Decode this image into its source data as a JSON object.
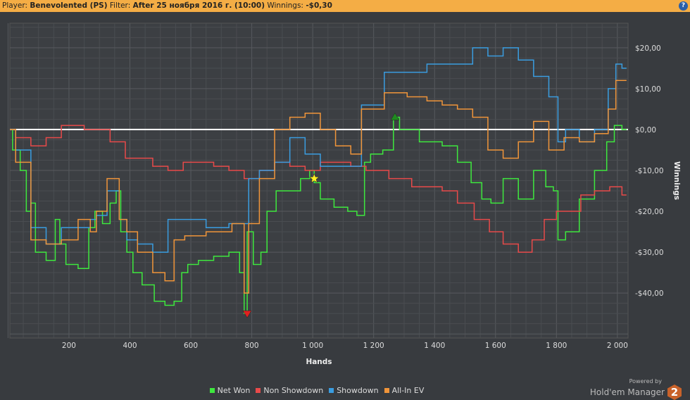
{
  "header": {
    "player_label": "Player:",
    "player": "Benevolented (PS)",
    "filter_label": "Filter:",
    "filter": "After 25 ноября 2016 г. (10:00)",
    "winnings_label": "Winnings:",
    "winnings": "-$0,30",
    "help": "?"
  },
  "brand": {
    "powered": "Powered by",
    "name": "Hold'em Manager",
    "logo": "2"
  },
  "chart_data": {
    "type": "line",
    "xlabel": "Hands",
    "ylabel": "Winnings",
    "xlim": [
      6,
      2035
    ],
    "ylim": [
      -51,
      26
    ],
    "xticks": [
      200,
      400,
      600,
      800,
      1000,
      1200,
      1400,
      1600,
      1800,
      2000
    ],
    "xtick_labels": [
      "200",
      "400",
      "600",
      "800",
      "1 000",
      "1 200",
      "1 400",
      "1 600",
      "1 800",
      "2 000"
    ],
    "yticks": [
      20,
      10,
      0,
      -10,
      -20,
      -30,
      -40
    ],
    "ytick_labels": [
      "$20,00",
      "$10,00",
      "$0,00",
      "-$10,00",
      "-$20,00",
      "-$30,00",
      "-$40,00"
    ],
    "grid": true,
    "legend_position": "bottom",
    "series": [
      {
        "name": "Net Won",
        "color": "#3ee83e",
        "points": [
          [
            0,
            0
          ],
          [
            30,
            -5
          ],
          [
            50,
            -10
          ],
          [
            70,
            -20
          ],
          [
            80,
            -18
          ],
          [
            100,
            -30
          ],
          [
            150,
            -32
          ],
          [
            160,
            -22
          ],
          [
            180,
            -28
          ],
          [
            200,
            -33
          ],
          [
            260,
            -34
          ],
          [
            270,
            -24
          ],
          [
            300,
            -20
          ],
          [
            320,
            -23
          ],
          [
            350,
            -18
          ],
          [
            360,
            -15
          ],
          [
            380,
            -25
          ],
          [
            400,
            -30
          ],
          [
            420,
            -35
          ],
          [
            460,
            -38
          ],
          [
            500,
            -42
          ],
          [
            530,
            -43
          ],
          [
            560,
            -42
          ],
          [
            580,
            -35
          ],
          [
            600,
            -33
          ],
          [
            650,
            -32
          ],
          [
            700,
            -31
          ],
          [
            750,
            -30
          ],
          [
            770,
            -35
          ],
          [
            780,
            -45
          ],
          [
            790,
            -25
          ],
          [
            820,
            -33
          ],
          [
            840,
            -30
          ],
          [
            860,
            -20
          ],
          [
            900,
            -15
          ],
          [
            940,
            -15
          ],
          [
            980,
            -12
          ],
          [
            1000,
            -10
          ],
          [
            1010,
            -13
          ],
          [
            1040,
            -17
          ],
          [
            1100,
            -19
          ],
          [
            1130,
            -20
          ],
          [
            1160,
            -21
          ],
          [
            1180,
            -8
          ],
          [
            1200,
            -6
          ],
          [
            1260,
            -5
          ],
          [
            1270,
            3
          ],
          [
            1300,
            0
          ],
          [
            1400,
            -3
          ],
          [
            1450,
            -4
          ],
          [
            1500,
            -8
          ],
          [
            1540,
            -13
          ],
          [
            1570,
            -17
          ],
          [
            1600,
            -18
          ],
          [
            1650,
            -12
          ],
          [
            1700,
            -17
          ],
          [
            1750,
            -10
          ],
          [
            1780,
            -14
          ],
          [
            1800,
            -15
          ],
          [
            1810,
            -27
          ],
          [
            1850,
            -25
          ],
          [
            1900,
            -17
          ],
          [
            1950,
            -10
          ],
          [
            1980,
            -3
          ],
          [
            2000,
            1
          ],
          [
            2030,
            0
          ]
        ]
      },
      {
        "name": "Non Showdown",
        "color": "#e84a4a",
        "points": [
          [
            0,
            0
          ],
          [
            50,
            -2
          ],
          [
            100,
            -4
          ],
          [
            150,
            -2
          ],
          [
            200,
            1
          ],
          [
            300,
            0
          ],
          [
            370,
            -3
          ],
          [
            400,
            -7
          ],
          [
            450,
            -7
          ],
          [
            500,
            -9
          ],
          [
            550,
            -10
          ],
          [
            600,
            -8
          ],
          [
            650,
            -8
          ],
          [
            700,
            -9
          ],
          [
            750,
            -10
          ],
          [
            800,
            -12
          ],
          [
            850,
            -10
          ],
          [
            900,
            -8
          ],
          [
            950,
            -9
          ],
          [
            1000,
            -10
          ],
          [
            1050,
            -8
          ],
          [
            1100,
            -8
          ],
          [
            1150,
            -9
          ],
          [
            1200,
            -10
          ],
          [
            1300,
            -12
          ],
          [
            1350,
            -14
          ],
          [
            1400,
            -14
          ],
          [
            1450,
            -15
          ],
          [
            1500,
            -18
          ],
          [
            1560,
            -22
          ],
          [
            1600,
            -25
          ],
          [
            1650,
            -28
          ],
          [
            1700,
            -30
          ],
          [
            1740,
            -27
          ],
          [
            1780,
            -22
          ],
          [
            1820,
            -20
          ],
          [
            1860,
            -20
          ],
          [
            1900,
            -16
          ],
          [
            1950,
            -15
          ],
          [
            2000,
            -14
          ],
          [
            2030,
            -16
          ]
        ]
      },
      {
        "name": "Showdown",
        "color": "#3a9de0",
        "points": [
          [
            0,
            0
          ],
          [
            50,
            -5
          ],
          [
            100,
            -24
          ],
          [
            150,
            -28
          ],
          [
            200,
            -24
          ],
          [
            260,
            -24
          ],
          [
            280,
            -22
          ],
          [
            300,
            -21
          ],
          [
            350,
            -15
          ],
          [
            380,
            -22
          ],
          [
            400,
            -27
          ],
          [
            450,
            -28
          ],
          [
            500,
            -30
          ],
          [
            550,
            -22
          ],
          [
            600,
            -22
          ],
          [
            700,
            -24
          ],
          [
            750,
            -23
          ],
          [
            780,
            -23
          ],
          [
            800,
            -12
          ],
          [
            850,
            -10
          ],
          [
            900,
            -8
          ],
          [
            950,
            -2
          ],
          [
            1000,
            -6
          ],
          [
            1050,
            -9
          ],
          [
            1100,
            -9
          ],
          [
            1150,
            -9
          ],
          [
            1170,
            6
          ],
          [
            1200,
            6
          ],
          [
            1270,
            14
          ],
          [
            1350,
            14
          ],
          [
            1400,
            16
          ],
          [
            1500,
            16
          ],
          [
            1550,
            20
          ],
          [
            1600,
            18
          ],
          [
            1650,
            20
          ],
          [
            1700,
            17
          ],
          [
            1750,
            13
          ],
          [
            1800,
            8
          ],
          [
            1810,
            -3
          ],
          [
            1850,
            0
          ],
          [
            1900,
            -3
          ],
          [
            1950,
            0
          ],
          [
            1990,
            10
          ],
          [
            2000,
            16
          ],
          [
            2030,
            15
          ]
        ]
      },
      {
        "name": "All-In EV",
        "color": "#f0953a",
        "points": [
          [
            0,
            0
          ],
          [
            50,
            -8
          ],
          [
            100,
            -27
          ],
          [
            150,
            -28
          ],
          [
            200,
            -27
          ],
          [
            260,
            -22
          ],
          [
            280,
            -25
          ],
          [
            300,
            -20
          ],
          [
            350,
            -12
          ],
          [
            380,
            -22
          ],
          [
            400,
            -25
          ],
          [
            450,
            -30
          ],
          [
            500,
            -35
          ],
          [
            530,
            -37
          ],
          [
            560,
            -27
          ],
          [
            600,
            -26
          ],
          [
            700,
            -25
          ],
          [
            770,
            -23
          ],
          [
            780,
            -40
          ],
          [
            800,
            -23
          ],
          [
            850,
            -12
          ],
          [
            900,
            0
          ],
          [
            950,
            3
          ],
          [
            1000,
            4
          ],
          [
            1050,
            0
          ],
          [
            1100,
            -4
          ],
          [
            1150,
            -6
          ],
          [
            1170,
            5
          ],
          [
            1200,
            5
          ],
          [
            1270,
            9
          ],
          [
            1350,
            8
          ],
          [
            1400,
            7
          ],
          [
            1450,
            6
          ],
          [
            1500,
            5
          ],
          [
            1550,
            3
          ],
          [
            1600,
            -5
          ],
          [
            1650,
            -7
          ],
          [
            1700,
            -3
          ],
          [
            1750,
            2
          ],
          [
            1800,
            -5
          ],
          [
            1850,
            -2
          ],
          [
            1900,
            -3
          ],
          [
            1950,
            -1
          ],
          [
            1990,
            5
          ],
          [
            2000,
            12
          ],
          [
            2030,
            12
          ]
        ]
      }
    ],
    "markers": [
      {
        "type": "min",
        "x": 785,
        "y": -45,
        "color": "#e02020"
      },
      {
        "type": "star",
        "x": 1005,
        "y": -12,
        "color": "#ffee22"
      },
      {
        "type": "max",
        "x": 1270,
        "y": 3,
        "color": "#1f8a1f"
      }
    ]
  }
}
